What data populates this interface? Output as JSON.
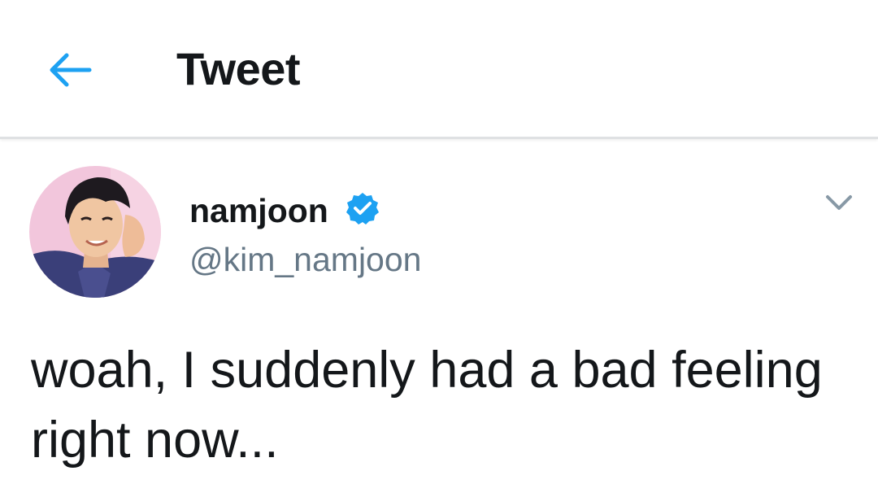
{
  "header": {
    "title": "Tweet",
    "back_icon": "arrow-left-icon"
  },
  "tweet": {
    "author": {
      "display_name": "namjoon",
      "handle": "@kim_namjoon",
      "verified_icon": "verified-badge-icon",
      "avatar_icon": "profile-photo"
    },
    "menu_icon": "chevron-down-icon",
    "text": "woah, I suddenly had a bad feeling right now..."
  },
  "colors": {
    "accent": "#1da1f2",
    "text": "#14171a",
    "secondary_text": "#657786",
    "divider": "#dfe1e3"
  }
}
